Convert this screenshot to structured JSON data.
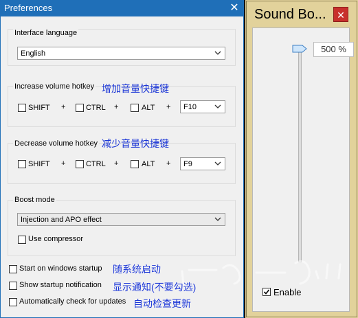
{
  "preferences": {
    "title": "Preferences",
    "close_glyph": "✕",
    "interface_language": {
      "label": "Interface language",
      "value": "English"
    },
    "increase_volume_hotkey": {
      "label": "Increase volume hotkey",
      "annotation": "增加音量快捷键",
      "shift": "SHIFT",
      "ctrl": "CTRL",
      "alt": "ALT",
      "plus": "+",
      "key": "F10"
    },
    "decrease_volume_hotkey": {
      "label": "Decrease volume hotkey",
      "annotation": "减少音量快捷键",
      "shift": "SHIFT",
      "ctrl": "CTRL",
      "alt": "ALT",
      "plus": "+",
      "key": "F9"
    },
    "boost_mode": {
      "label": "Boost mode",
      "value": "Injection and APO effect",
      "use_compressor": "Use compressor"
    },
    "start_on_windows_startup": {
      "label": "Start on windows startup",
      "annotation": "随系统启动"
    },
    "show_startup_notification": {
      "label": "Show startup notification",
      "annotation": "显示通知(不要勾选)"
    },
    "auto_check_updates": {
      "label": "Automatically check for updates",
      "annotation": "自动检查更新"
    }
  },
  "sound_booster": {
    "title": "Sound Bo...",
    "close_glyph": "✕",
    "volume_readout": "500 %",
    "volume_level_fraction": 1.0,
    "enable_label": "Enable",
    "enable_checked": true
  },
  "colors": {
    "pref_titlebar": "#1f6fb8",
    "sb_frame": "#e2d29b",
    "sb_close": "#c8302c",
    "annotation_text": "#1a35d6"
  }
}
